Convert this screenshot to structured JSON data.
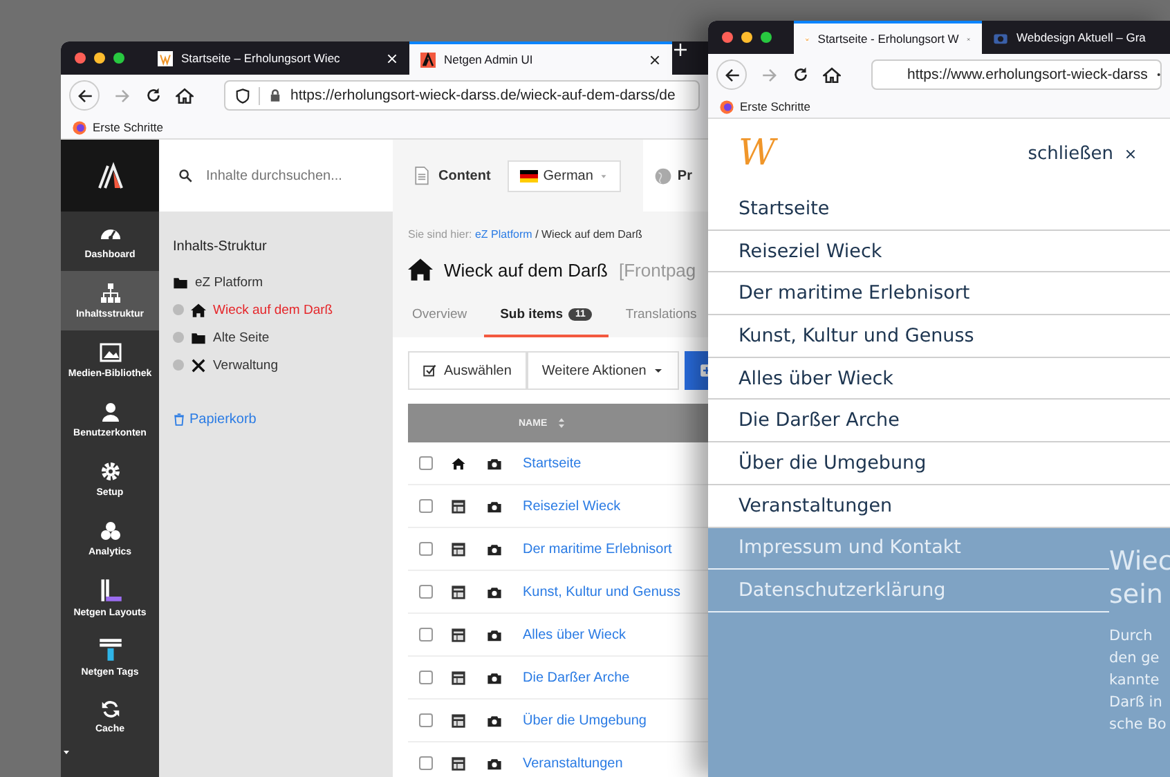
{
  "admin_window": {
    "tabs": [
      {
        "title": "Startseite – Erholungsort Wiec",
        "selected": false
      },
      {
        "title": "Netgen Admin UI",
        "selected": true
      }
    ],
    "url": "https://erholungsort-wieck-darss.de/wieck-auf-dem-darss/de",
    "bookmark": "Erste Schritte",
    "nav_items": [
      {
        "label": "Dashboard",
        "kind": "dashboard",
        "selected": false
      },
      {
        "label": "Inhaltsstruktur",
        "kind": "sitemap",
        "selected": true
      },
      {
        "label": "Medien-Bibliothek",
        "kind": "image",
        "selected": false
      },
      {
        "label": "Benutzerkonten",
        "kind": "user",
        "selected": false
      },
      {
        "label": "Setup",
        "kind": "gear",
        "selected": false
      },
      {
        "label": "Analytics",
        "kind": "cubes",
        "selected": false
      },
      {
        "label": "Netgen Layouts",
        "kind": "layouts",
        "selected": false
      },
      {
        "label": "Netgen Tags",
        "kind": "tags",
        "selected": false
      },
      {
        "label": "Cache",
        "kind": "refresh",
        "selected": false
      }
    ],
    "search": {
      "placeholder": "Inhalte durchsuchen..."
    },
    "tree_title": "Inhalts-Struktur",
    "tree": [
      {
        "label": "eZ Platform",
        "kind": "folder",
        "selected": false,
        "children": [
          {
            "label": "Wieck auf dem Darß",
            "kind": "home",
            "selected": true
          },
          {
            "label": "Alte Seite",
            "kind": "folder",
            "selected": false
          },
          {
            "label": "Verwaltung",
            "kind": "tools",
            "selected": false
          }
        ]
      }
    ],
    "trash_link": "Papierkorb",
    "topbar": {
      "content": "Content",
      "language": "German",
      "preview": "Pr"
    },
    "breadcrumb": {
      "prefix": "Sie sind hier:",
      "link": "eZ Platform",
      "current": "/ Wieck auf dem Darß"
    },
    "title": "Wieck auf dem Darß",
    "subtitle": "[Frontpag",
    "content_tabs": [
      {
        "label": "Overview",
        "selected": false
      },
      {
        "label": "Sub items",
        "badge": "11",
        "selected": true
      },
      {
        "label": "Translations",
        "selected": false
      }
    ],
    "actions": [
      "Auswählen",
      "Weitere Aktionen"
    ],
    "table": {
      "columns": [
        "NAME"
      ],
      "rows": [
        {
          "kind": "home",
          "name": "Startseite",
          "checked": false
        },
        {
          "kind": "layout",
          "name": "Reiseziel Wieck",
          "checked": false
        },
        {
          "kind": "layout",
          "name": "Der maritime Erlebnisort",
          "checked": false
        },
        {
          "kind": "layout",
          "name": "Kunst, Kultur und Genuss",
          "checked": false
        },
        {
          "kind": "layout",
          "name": "Alles über Wieck",
          "checked": false
        },
        {
          "kind": "layout",
          "name": "Die Darßer Arche",
          "checked": false
        },
        {
          "kind": "layout",
          "name": "Über die Umgebung",
          "checked": false
        },
        {
          "kind": "layout",
          "name": "Veranstaltungen",
          "checked": false
        }
      ]
    }
  },
  "site_window": {
    "tabs": [
      {
        "title": "Startseite - Erholungsort W",
        "selected": true
      },
      {
        "title": "Webdesign Aktuell – Gra",
        "selected": false
      }
    ],
    "url": "https://www.erholungsort-wieck-darss",
    "bookmark": "Erste Schritte",
    "logo": "W",
    "close_label": "schließen",
    "menu_items": [
      "Startseite",
      "Reiseziel Wieck",
      "Der maritime Erlebnisort",
      "Kunst, Kultur und Genuss",
      "Alles über Wieck",
      "Die Darßer Arche",
      "Über die Umgebung",
      "Veranstaltungen"
    ],
    "overlay_menu_items": [
      "Impressum und Kontakt",
      "Datenschutzerklärung"
    ],
    "page_heading": [
      "Wiec",
      "sein"
    ],
    "page_text": [
      "Durch",
      "den ge",
      "kannte",
      "Darß in",
      "sche Bo"
    ]
  }
}
